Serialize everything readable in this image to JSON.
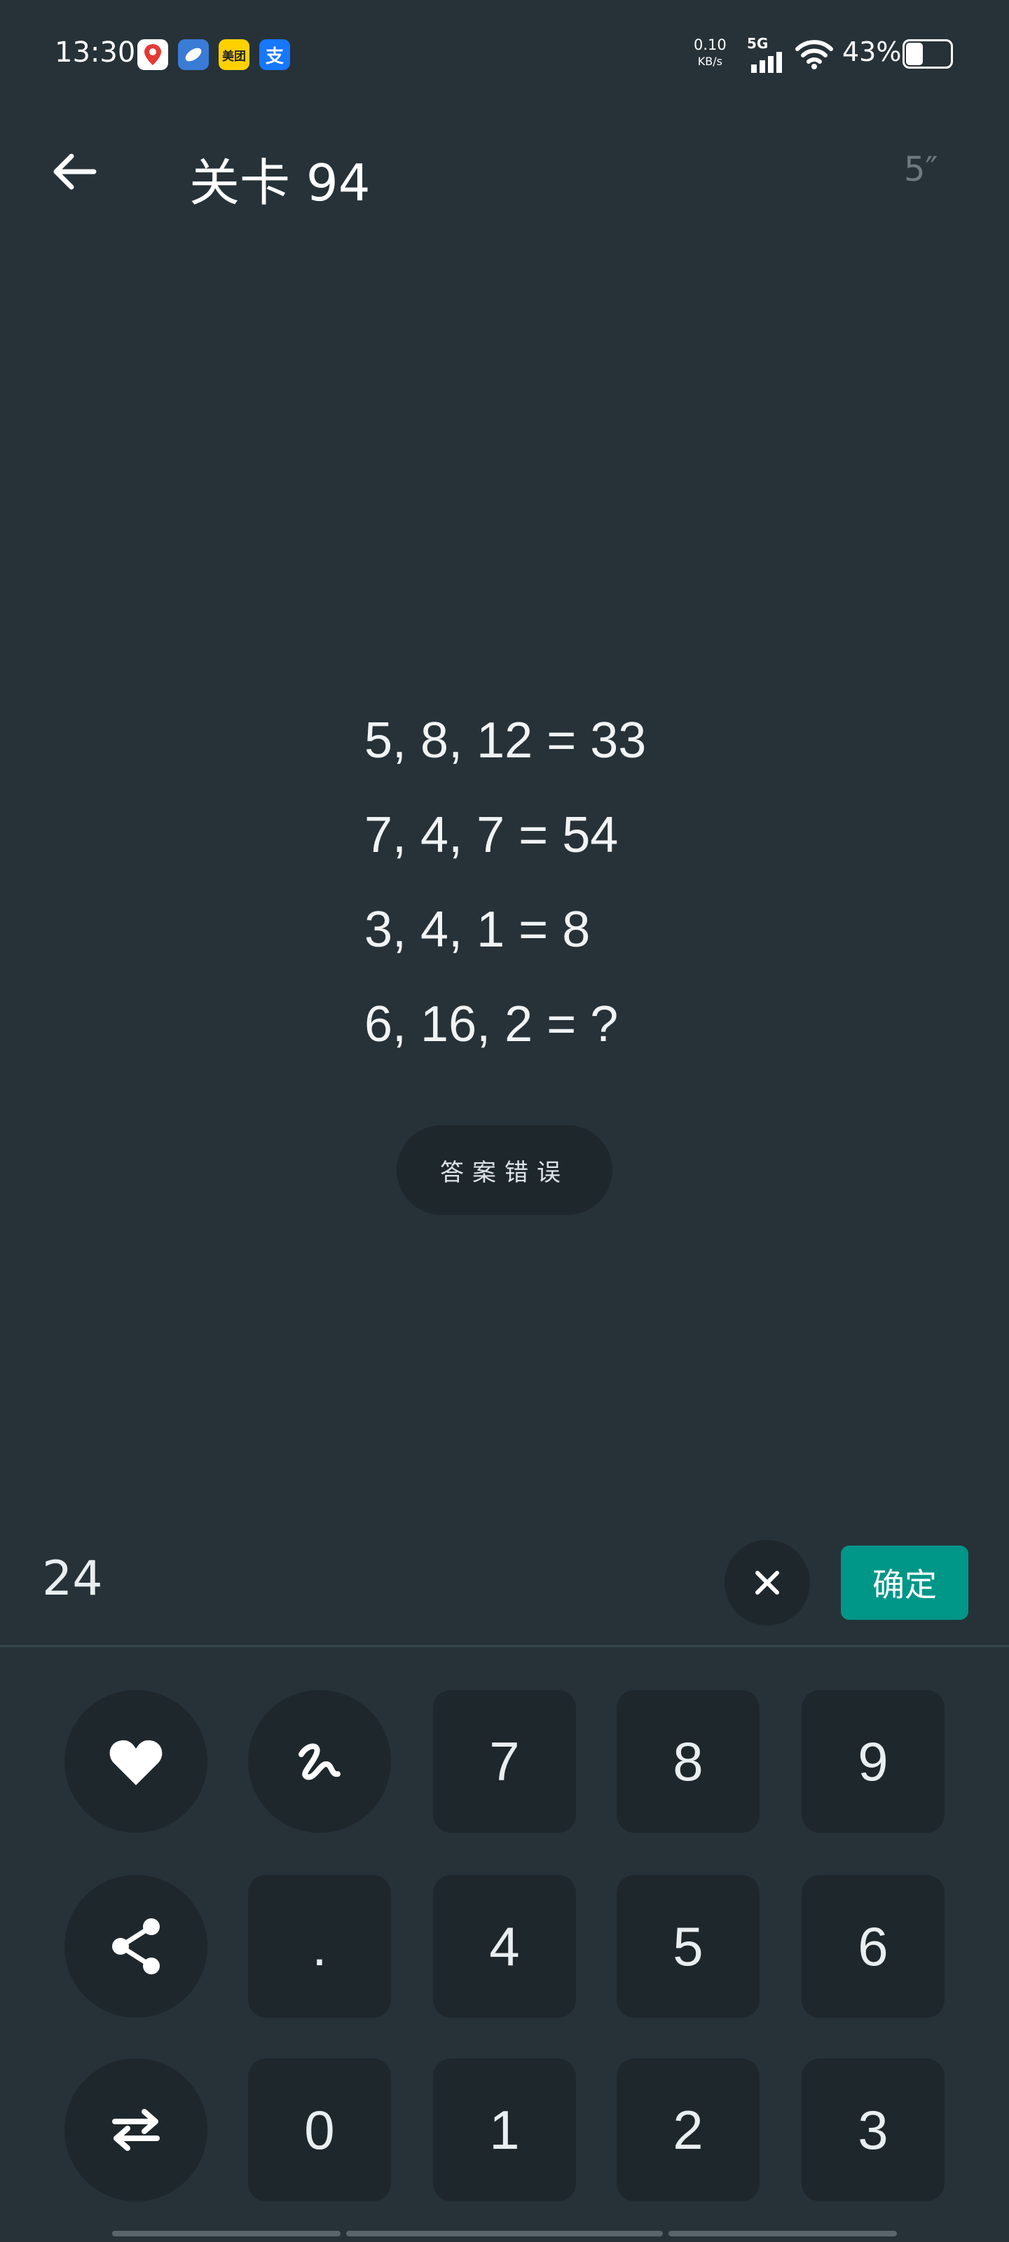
{
  "status_bar": {
    "time": "13:30",
    "app_icons": [
      {
        "name": "maps-app-icon",
        "label": "",
        "color": "#ffffff"
      },
      {
        "name": "browser-app-icon",
        "label": "",
        "color": "#3a7bd5"
      },
      {
        "name": "meituan-app-icon",
        "label": "美团",
        "color": "#ffd100"
      },
      {
        "name": "alipay-app-icon",
        "label": "支",
        "color": "#1677ff"
      }
    ],
    "net_speed": "0.10",
    "net_unit": "KB/s",
    "signal": "5G",
    "battery": "43%",
    "battery_level": 0.43
  },
  "header": {
    "back_icon": "arrow-left-icon",
    "title": "关卡 94",
    "timer": "5″"
  },
  "puzzle": {
    "lines": [
      "5, 8, 12 = 33",
      "7, 4, 7 = 54",
      "3, 4, 1 = 8",
      "6, 16, 2 = ?"
    ]
  },
  "feedback": {
    "label": "答案错误"
  },
  "answer": {
    "value": "24",
    "clear_icon": "close-icon",
    "confirm_label": "确定"
  },
  "keypad": {
    "row1": [
      "7",
      "8",
      "9"
    ],
    "row2": [
      ".",
      "4",
      "5",
      "6"
    ],
    "row3": [
      "0",
      "1",
      "2",
      "3"
    ],
    "side_icons": [
      "heart-icon",
      "hint-squiggle-icon",
      "share-icon",
      "swap-icon"
    ]
  },
  "colors": {
    "background": "#263238",
    "key": "#1e272c",
    "accent": "#009688"
  }
}
